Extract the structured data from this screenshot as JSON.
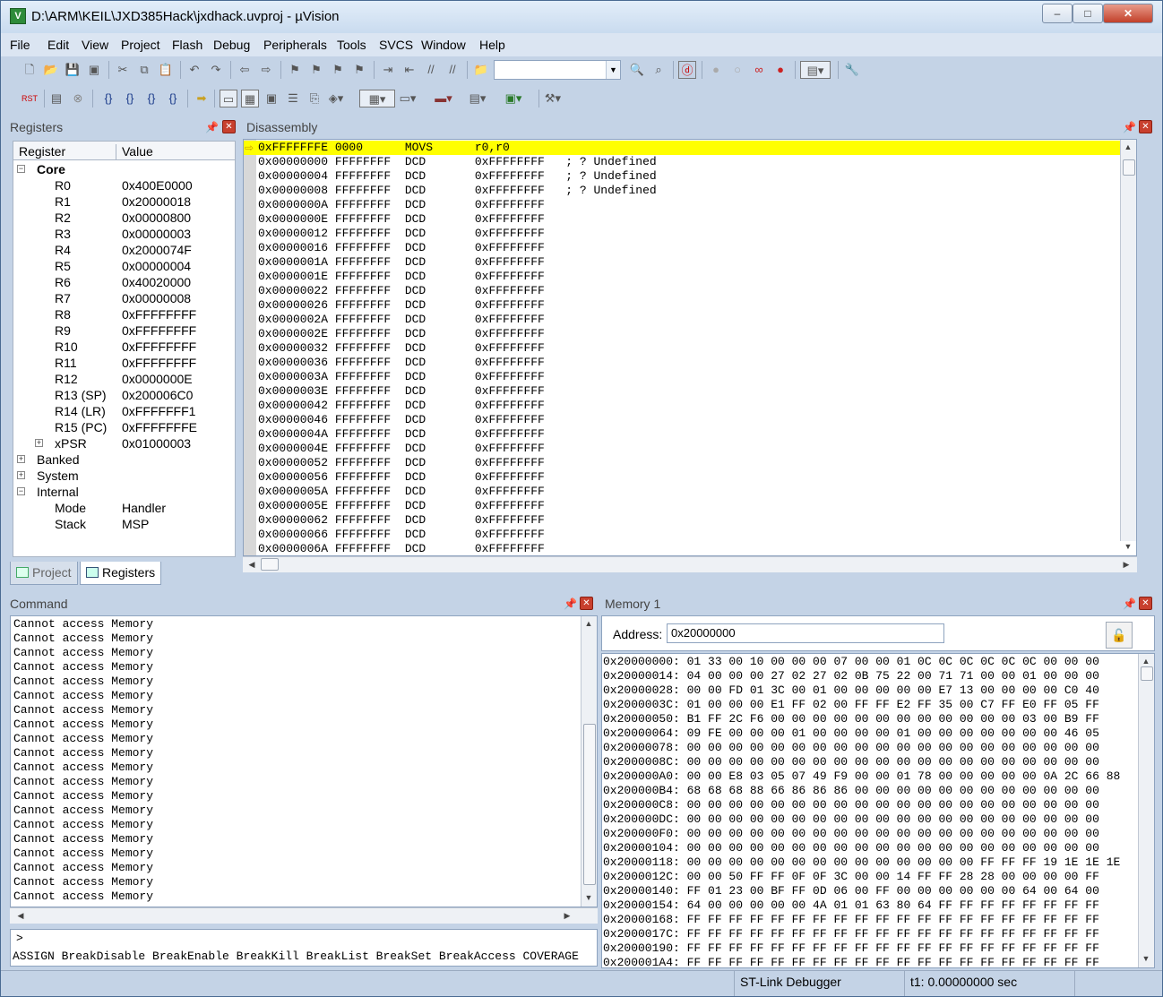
{
  "window": {
    "title": "D:\\ARM\\KEIL\\JXD385Hack\\jxdhack.uvproj - µVision",
    "minimize": "–",
    "maximize": "□",
    "close": "✕"
  },
  "menu": [
    "File",
    "Edit",
    "View",
    "Project",
    "Flash",
    "Debug",
    "Peripherals",
    "Tools",
    "SVCS",
    "Window",
    "Help"
  ],
  "toolbar": {
    "find_value": ""
  },
  "registers": {
    "title": "Registers",
    "col_register": "Register",
    "col_value": "Value",
    "groups": {
      "core": "Core",
      "banked": "Banked",
      "system": "System",
      "internal": "Internal"
    },
    "core": [
      {
        "name": "R0",
        "value": "0x400E0000"
      },
      {
        "name": "R1",
        "value": "0x20000018"
      },
      {
        "name": "R2",
        "value": "0x00000800"
      },
      {
        "name": "R3",
        "value": "0x00000003"
      },
      {
        "name": "R4",
        "value": "0x2000074F"
      },
      {
        "name": "R5",
        "value": "0x00000004"
      },
      {
        "name": "R6",
        "value": "0x40020000"
      },
      {
        "name": "R7",
        "value": "0x00000008"
      },
      {
        "name": "R8",
        "value": "0xFFFFFFFF"
      },
      {
        "name": "R9",
        "value": "0xFFFFFFFF"
      },
      {
        "name": "R10",
        "value": "0xFFFFFFFF"
      },
      {
        "name": "R11",
        "value": "0xFFFFFFFF"
      },
      {
        "name": "R12",
        "value": "0x0000000E"
      },
      {
        "name": "R13 (SP)",
        "value": "0x200006C0"
      },
      {
        "name": "R14 (LR)",
        "value": "0xFFFFFFF1"
      },
      {
        "name": "R15 (PC)",
        "value": "0xFFFFFFFE"
      },
      {
        "name": "xPSR",
        "value": "0x01000003"
      }
    ],
    "internal": [
      {
        "name": "Mode",
        "value": "Handler"
      },
      {
        "name": "Stack",
        "value": "MSP"
      }
    ],
    "tabs": {
      "project": "Project",
      "registers": "Registers"
    }
  },
  "disassembly": {
    "title": "Disassembly",
    "lines": [
      "0xFFFFFFFE 0000      MOVS      r0,r0",
      "0x00000000 FFFFFFFF  DCD       0xFFFFFFFF   ; ? Undefined",
      "0x00000004 FFFFFFFF  DCD       0xFFFFFFFF   ; ? Undefined",
      "0x00000008 FFFFFFFF  DCD       0xFFFFFFFF   ; ? Undefined",
      "0x0000000A FFFFFFFF  DCD       0xFFFFFFFF",
      "0x0000000E FFFFFFFF  DCD       0xFFFFFFFF",
      "0x00000012 FFFFFFFF  DCD       0xFFFFFFFF",
      "0x00000016 FFFFFFFF  DCD       0xFFFFFFFF",
      "0x0000001A FFFFFFFF  DCD       0xFFFFFFFF",
      "0x0000001E FFFFFFFF  DCD       0xFFFFFFFF",
      "0x00000022 FFFFFFFF  DCD       0xFFFFFFFF",
      "0x00000026 FFFFFFFF  DCD       0xFFFFFFFF",
      "0x0000002A FFFFFFFF  DCD       0xFFFFFFFF",
      "0x0000002E FFFFFFFF  DCD       0xFFFFFFFF",
      "0x00000032 FFFFFFFF  DCD       0xFFFFFFFF",
      "0x00000036 FFFFFFFF  DCD       0xFFFFFFFF",
      "0x0000003A FFFFFFFF  DCD       0xFFFFFFFF",
      "0x0000003E FFFFFFFF  DCD       0xFFFFFFFF",
      "0x00000042 FFFFFFFF  DCD       0xFFFFFFFF",
      "0x00000046 FFFFFFFF  DCD       0xFFFFFFFF",
      "0x0000004A FFFFFFFF  DCD       0xFFFFFFFF",
      "0x0000004E FFFFFFFF  DCD       0xFFFFFFFF",
      "0x00000052 FFFFFFFF  DCD       0xFFFFFFFF",
      "0x00000056 FFFFFFFF  DCD       0xFFFFFFFF",
      "0x0000005A FFFFFFFF  DCD       0xFFFFFFFF",
      "0x0000005E FFFFFFFF  DCD       0xFFFFFFFF",
      "0x00000062 FFFFFFFF  DCD       0xFFFFFFFF",
      "0x00000066 FFFFFFFF  DCD       0xFFFFFFFF",
      "0x0000006A FFFFFFFF  DCD       0xFFFFFFFF"
    ]
  },
  "command": {
    "title": "Command",
    "lines": [
      "Cannot access Memory",
      "Cannot access Memory",
      "Cannot access Memory",
      "Cannot access Memory",
      "Cannot access Memory",
      "Cannot access Memory",
      "Cannot access Memory",
      "Cannot access Memory",
      "Cannot access Memory",
      "Cannot access Memory",
      "Cannot access Memory",
      "Cannot access Memory",
      "Cannot access Memory",
      "Cannot access Memory",
      "Cannot access Memory",
      "Cannot access Memory",
      "Cannot access Memory",
      "Cannot access Memory",
      "Cannot access Memory",
      "Cannot access Memory"
    ],
    "prompt": ">",
    "hint": "ASSIGN BreakDisable BreakEnable BreakKill BreakList BreakSet BreakAccess COVERAGE"
  },
  "memory": {
    "title": "Memory 1",
    "address_label": "Address:",
    "address": "0x20000000",
    "lines": [
      "0x20000000: 01 33 00 10 00 00 00 07 00 00 01 0C 0C 0C 0C 0C 0C 00 00 00",
      "0x20000014: 04 00 00 00 27 02 27 02 0B 75 22 00 71 71 00 00 01 00 00 00",
      "0x20000028: 00 00 FD 01 3C 00 01 00 00 00 00 00 E7 13 00 00 00 00 C0 40",
      "0x2000003C: 01 00 00 00 E1 FF 02 00 FF FF E2 FF 35 00 C7 FF E0 FF 05 FF",
      "0x20000050: B1 FF 2C F6 00 00 00 00 00 00 00 00 00 00 00 00 03 00 B9 FF",
      "0x20000064: 09 FE 00 00 00 01 00 00 00 00 01 00 00 00 00 00 00 00 46 05",
      "0x20000078: 00 00 00 00 00 00 00 00 00 00 00 00 00 00 00 00 00 00 00 00",
      "0x2000008C: 00 00 00 00 00 00 00 00 00 00 00 00 00 00 00 00 00 00 00 00",
      "0x200000A0: 00 00 E8 03 05 07 49 F9 00 00 01 78 00 00 00 00 00 0A 2C 66 88",
      "0x200000B4: 68 68 68 88 66 86 86 86 00 00 00 00 00 00 00 00 00 00 00 00",
      "0x200000C8: 00 00 00 00 00 00 00 00 00 00 00 00 00 00 00 00 00 00 00 00",
      "0x200000DC: 00 00 00 00 00 00 00 00 00 00 00 00 00 00 00 00 00 00 00 00",
      "0x200000F0: 00 00 00 00 00 00 00 00 00 00 00 00 00 00 00 00 00 00 00 00",
      "0x20000104: 00 00 00 00 00 00 00 00 00 00 00 00 00 00 00 00 00 00 00 00",
      "0x20000118: 00 00 00 00 00 00 00 00 00 00 00 00 00 00 FF FF FF 19 1E 1E 1E",
      "0x2000012C: 00 00 50 FF FF 0F 0F 3C 00 00 14 FF FF 28 28 00 00 00 00 FF",
      "0x20000140: FF 01 23 00 BF FF 0D 06 00 FF 00 00 00 00 00 00 64 00 64 00",
      "0x20000154: 64 00 00 00 00 00 4A 01 01 63 80 64 FF FF FF FF FF FF FF FF",
      "0x20000168: FF FF FF FF FF FF FF FF FF FF FF FF FF FF FF FF FF FF FF FF",
      "0x2000017C: FF FF FF FF FF FF FF FF FF FF FF FF FF FF FF FF FF FF FF FF",
      "0x20000190: FF FF FF FF FF FF FF FF FF FF FF FF FF FF FF FF FF FF FF FF",
      "0x200001A4: FF FF FF FF FF FF FF FF FF FF FF FF FF FF FF FF FF FF FF FF"
    ]
  },
  "status": {
    "debugger": "ST-Link Debugger",
    "time": "t1: 0.00000000 sec"
  }
}
